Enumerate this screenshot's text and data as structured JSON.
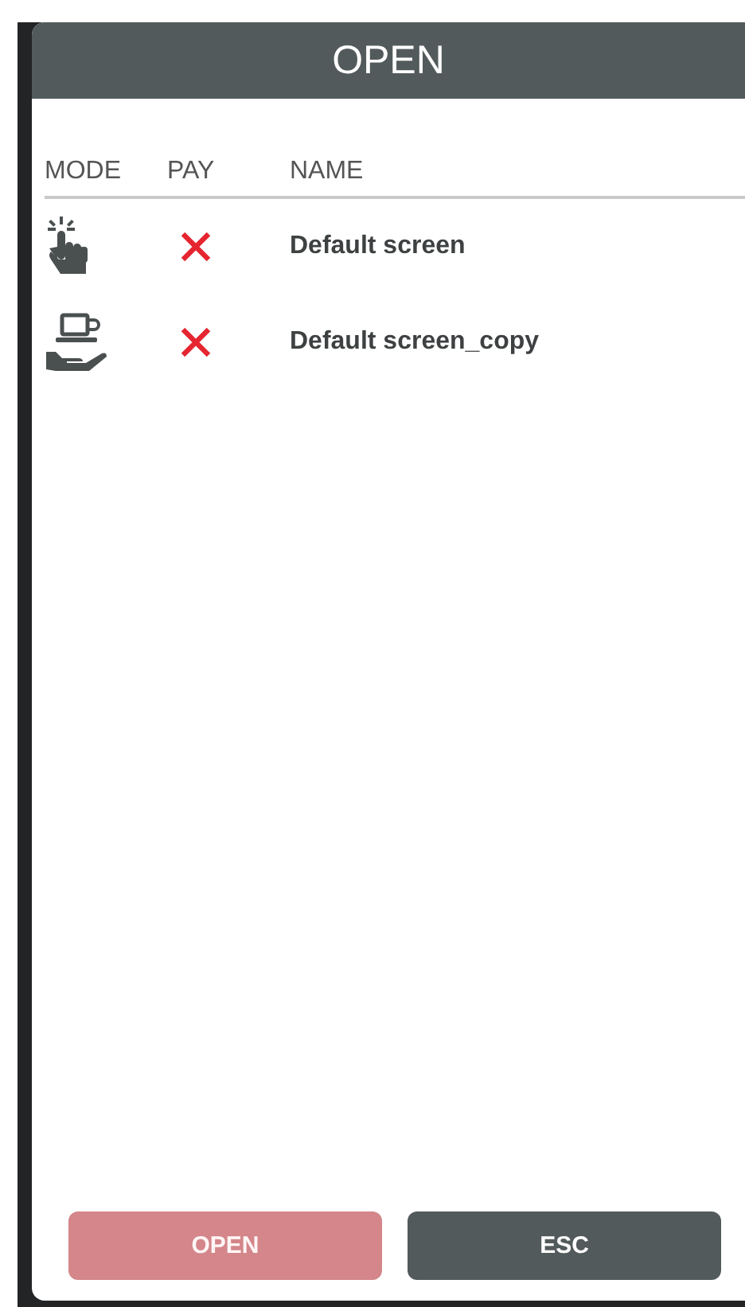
{
  "dialog": {
    "title": "OPEN"
  },
  "columns": [
    "MODE",
    "PAY",
    "NAME"
  ],
  "rows": [
    {
      "mode": {
        "kind": "tap"
      },
      "paid": false,
      "name": "Default screen"
    },
    {
      "mode": {
        "kind": "serve"
      },
      "paid": false,
      "name": "Default screen_copy"
    }
  ],
  "buttons": [
    {
      "label": "OPEN",
      "disabled": true
    },
    {
      "label": "ESC",
      "disabled": false
    }
  ]
}
